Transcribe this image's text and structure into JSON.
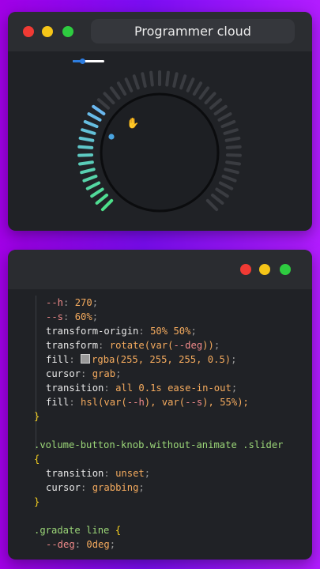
{
  "window_top": {
    "title": "Programmer cloud",
    "buttons": [
      "close",
      "minimize",
      "maximize"
    ],
    "mini_slider": {
      "level": 0.3
    },
    "knob": {
      "active_ticks": 14,
      "total_ticks": 45,
      "gradient": [
        "#6ab8f0",
        "#4de08a"
      ]
    }
  },
  "window_bottom": {
    "code_lines": [
      {
        "indent": 1,
        "parts": [
          {
            "t": "--h",
            "c": "var"
          },
          {
            "t": ": ",
            "c": "punc"
          },
          {
            "t": "270",
            "c": "num"
          },
          {
            "t": ";",
            "c": "punc"
          }
        ]
      },
      {
        "indent": 1,
        "parts": [
          {
            "t": "--s",
            "c": "var"
          },
          {
            "t": ": ",
            "c": "punc"
          },
          {
            "t": "60%",
            "c": "num"
          },
          {
            "t": ";",
            "c": "punc"
          }
        ]
      },
      {
        "indent": 1,
        "parts": [
          {
            "t": "transform-origin",
            "c": "prop"
          },
          {
            "t": ": ",
            "c": "punc"
          },
          {
            "t": "50% 50%",
            "c": "num"
          },
          {
            "t": ";",
            "c": "punc"
          }
        ]
      },
      {
        "indent": 1,
        "parts": [
          {
            "t": "transform",
            "c": "prop"
          },
          {
            "t": ": ",
            "c": "punc"
          },
          {
            "t": "rotate(",
            "c": "kw"
          },
          {
            "t": "var(",
            "c": "kw"
          },
          {
            "t": "--deg",
            "c": "var"
          },
          {
            "t": "))",
            "c": "kw"
          },
          {
            "t": ";",
            "c": "punc"
          }
        ]
      },
      {
        "indent": 1,
        "parts": [
          {
            "t": "fill",
            "c": "prop"
          },
          {
            "t": ": ",
            "c": "punc"
          },
          {
            "t": "",
            "c": "swatch"
          },
          {
            "t": "rgba(255, 255, 255, 0.5)",
            "c": "num"
          },
          {
            "t": ";",
            "c": "punc"
          }
        ]
      },
      {
        "indent": 1,
        "parts": [
          {
            "t": "cursor",
            "c": "prop"
          },
          {
            "t": ": ",
            "c": "punc"
          },
          {
            "t": "grab",
            "c": "kw"
          },
          {
            "t": ";",
            "c": "punc"
          }
        ]
      },
      {
        "indent": 1,
        "parts": [
          {
            "t": "transition",
            "c": "prop"
          },
          {
            "t": ": ",
            "c": "punc"
          },
          {
            "t": "all 0.1s ease-in-out",
            "c": "kw"
          },
          {
            "t": ";",
            "c": "punc"
          }
        ]
      },
      {
        "indent": 1,
        "parts": [
          {
            "t": "fill",
            "c": "prop"
          },
          {
            "t": ": ",
            "c": "punc"
          },
          {
            "t": "hsl(",
            "c": "kw"
          },
          {
            "t": "var(",
            "c": "kw"
          },
          {
            "t": "--h",
            "c": "var"
          },
          {
            "t": "), ",
            "c": "kw"
          },
          {
            "t": "var(",
            "c": "kw"
          },
          {
            "t": "--s",
            "c": "var"
          },
          {
            "t": "), ",
            "c": "kw"
          },
          {
            "t": "55%",
            "c": "num"
          },
          {
            "t": ");",
            "c": "kw"
          }
        ]
      },
      {
        "indent": 0,
        "parts": [
          {
            "t": "}",
            "c": "brace"
          }
        ]
      },
      {
        "indent": 0,
        "parts": [
          {
            "t": "",
            "c": "punc"
          }
        ]
      },
      {
        "indent": 0,
        "parts": [
          {
            "t": ".volume-button-knob.without-animate .slider",
            "c": "sel"
          }
        ]
      },
      {
        "indent": 0,
        "parts": [
          {
            "t": "{",
            "c": "brace"
          }
        ]
      },
      {
        "indent": 1,
        "parts": [
          {
            "t": "transition",
            "c": "prop"
          },
          {
            "t": ": ",
            "c": "punc"
          },
          {
            "t": "unset",
            "c": "kw"
          },
          {
            "t": ";",
            "c": "punc"
          }
        ]
      },
      {
        "indent": 1,
        "parts": [
          {
            "t": "cursor",
            "c": "prop"
          },
          {
            "t": ": ",
            "c": "punc"
          },
          {
            "t": "grabbing",
            "c": "kw"
          },
          {
            "t": ";",
            "c": "punc"
          }
        ]
      },
      {
        "indent": 0,
        "parts": [
          {
            "t": "}",
            "c": "brace"
          }
        ]
      },
      {
        "indent": 0,
        "parts": [
          {
            "t": "",
            "c": "punc"
          }
        ]
      },
      {
        "indent": 0,
        "parts": [
          {
            "t": ".gradate line ",
            "c": "sel"
          },
          {
            "t": "{",
            "c": "brace"
          }
        ]
      },
      {
        "indent": 1,
        "parts": [
          {
            "t": "--deg",
            "c": "var"
          },
          {
            "t": ": ",
            "c": "punc"
          },
          {
            "t": "0deg",
            "c": "num"
          },
          {
            "t": ";",
            "c": "punc"
          }
        ]
      }
    ]
  },
  "colors": {
    "background": "#8a0cf0",
    "window": "#202226",
    "titlebar": "#2b2d31",
    "close": "#f03a34",
    "minimize": "#f5c518",
    "maximize": "#2ecc40"
  }
}
